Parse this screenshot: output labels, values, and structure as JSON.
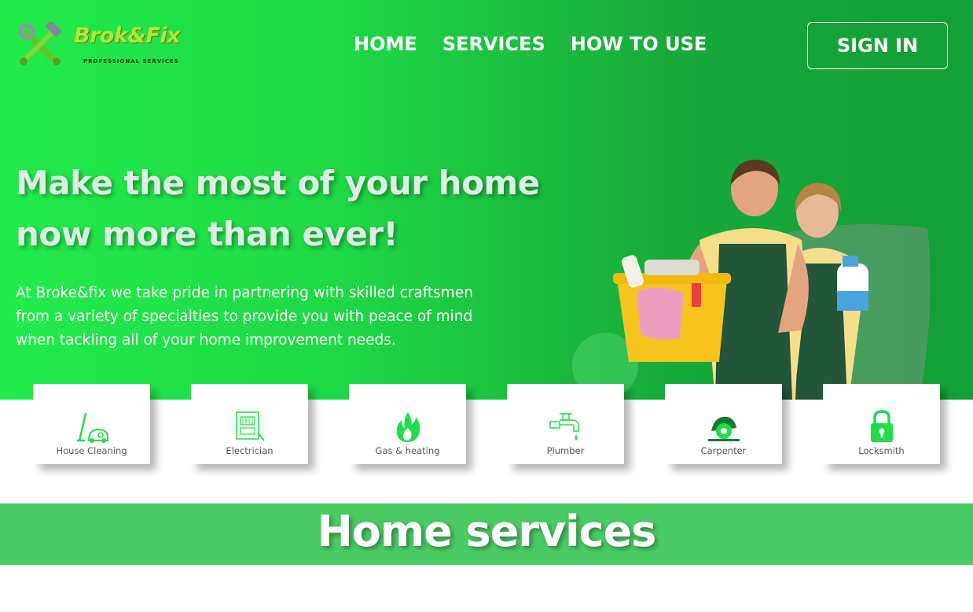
{
  "brand": {
    "name": "Brok&Fix",
    "tagline": "PROFESSIONAL SERVICES"
  },
  "nav": {
    "items": [
      {
        "label": "HOME"
      },
      {
        "label": "SERVICES"
      },
      {
        "label": "HOW TO USE"
      }
    ],
    "signin_label": "SIGN IN"
  },
  "hero": {
    "headline_line1": "Make the most of your home",
    "headline_line2": "now more than ever!",
    "intro_line1": "At Broke&fix we take pride in partnering with skilled craftsmen",
    "intro_line2": "from a variety of specialties to provide you with peace of mind",
    "intro_line3": "when tackling all of your home improvement needs."
  },
  "services": [
    {
      "label": "House Cleaning",
      "icon": "vacuum-cleaner-icon"
    },
    {
      "label": "Electrician",
      "icon": "electrical-panel-icon"
    },
    {
      "label": "Gas & heating",
      "icon": "flame-icon"
    },
    {
      "label": "Plumber",
      "icon": "faucet-icon"
    },
    {
      "label": "Carpenter",
      "icon": "circular-saw-icon"
    },
    {
      "label": "Locksmith",
      "icon": "padlock-icon"
    }
  ],
  "section": {
    "title": "Home services"
  },
  "colors": {
    "brand_green": "#1fd846",
    "icon_green": "#22dd4a",
    "band_green": "#4bcb64"
  }
}
